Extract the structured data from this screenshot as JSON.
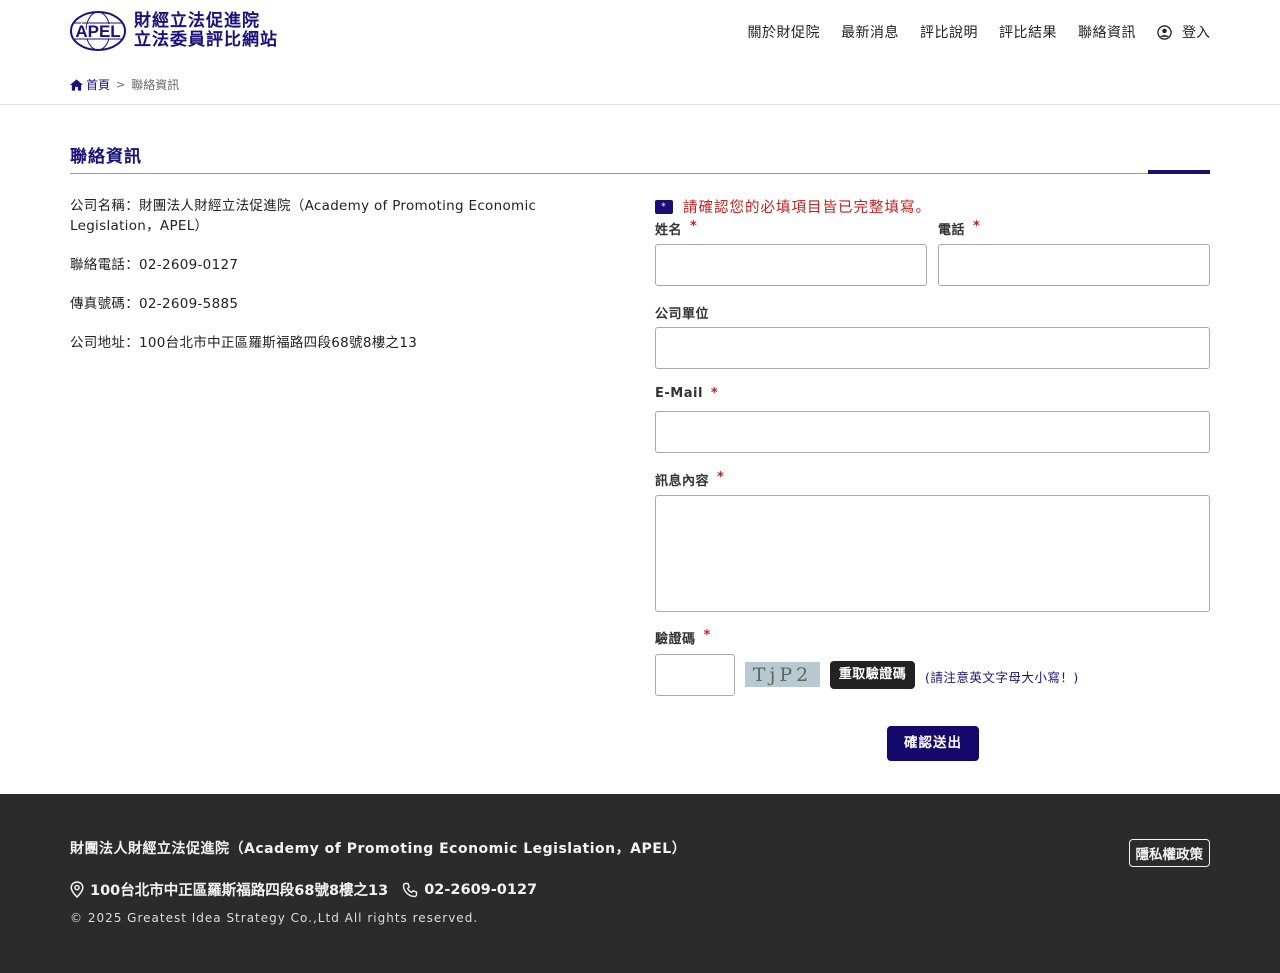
{
  "header": {
    "logo_mark": "APEL",
    "logo_line1": "財經立法促進院",
    "logo_line2": "立法委員評比網站",
    "nav": [
      "關於財促院",
      "最新消息",
      "評比說明",
      "評比結果",
      "聯絡資訊"
    ],
    "login_label": "登入"
  },
  "breadcrumb": {
    "home": "首頁",
    "separator": ">",
    "current": "聯絡資訊"
  },
  "section_title": "聯絡資訊",
  "info": {
    "company": "公司名稱：財團法人財經立法促進院（Academy of Promoting Economic Legislation，APEL）",
    "phone": "聯絡電話：02-2609-0127",
    "fax": "傳真號碼：02-2609-5885",
    "address": "公司地址：100台北市中正區羅斯福路四段68號8樓之13"
  },
  "form": {
    "notice_badge": "*",
    "notice": "請確認您的必填項目皆已完整填寫。",
    "required_mark": "*",
    "name_label": "姓名",
    "name_value": "",
    "phone_label": "電話",
    "phone_value": "",
    "company_label": "公司單位",
    "company_value": "",
    "email_label": "E-Mail",
    "email_value": "",
    "message_label": "訊息內容",
    "message_value": "",
    "captcha_label": "驗證碼",
    "captcha_value": "",
    "captcha_text": "TjP2",
    "captcha_refresh": "重取驗證碼",
    "captcha_hint": "(請注意英文字母大小寫！)",
    "submit_label": "確認送出"
  },
  "footer": {
    "org": "財團法人財經立法促進院（Academy of Promoting Economic Legislation，APEL）",
    "privacy": "隱私權政策",
    "address": "100台北市中正區羅斯福路四段68號8樓之13",
    "phone": "02-2609-0127",
    "copyright": "© 2025 Greatest Idea Strategy Co.,Ltd All rights reserved."
  },
  "colors": {
    "brand": "#1a127a",
    "accent": "#14086b",
    "required": "#c0211f",
    "footer_bg": "#2b2b2b"
  }
}
